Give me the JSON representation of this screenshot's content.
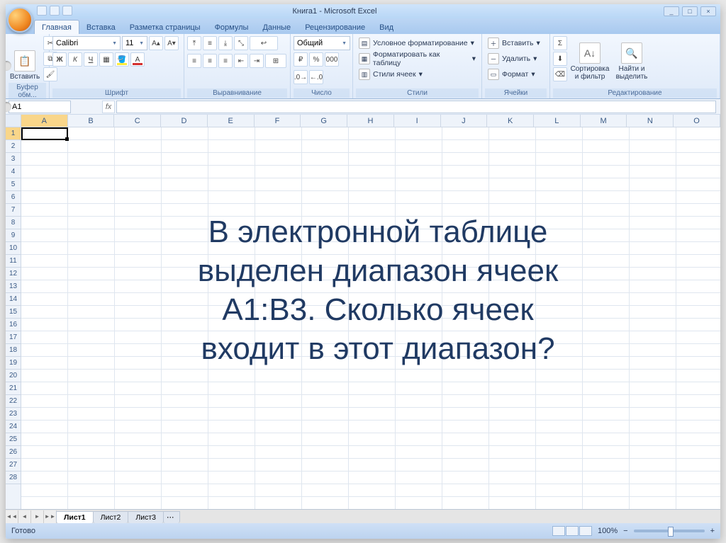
{
  "window": {
    "title": "Книга1 - Microsoft Excel",
    "minimize": "_",
    "maximize": "□",
    "close": "×"
  },
  "tabs": {
    "home": "Главная",
    "insert": "Вставка",
    "layout": "Разметка страницы",
    "formulas": "Формулы",
    "data": "Данные",
    "review": "Рецензирование",
    "view": "Вид"
  },
  "ribbon": {
    "clipboard": {
      "title": "Буфер обм...",
      "paste": "Вставить"
    },
    "font": {
      "title": "Шрифт",
      "name": "Calibri",
      "size": "11",
      "bold": "Ж",
      "italic": "К",
      "underline": "Ч"
    },
    "alignment": {
      "title": "Выравнивание"
    },
    "number": {
      "title": "Число",
      "format": "Общий",
      "percent": "%",
      "thousands": "000"
    },
    "styles": {
      "title": "Стили",
      "conditional": "Условное форматирование",
      "asTable": "Форматировать как таблицу",
      "cellStyles": "Стили ячеек"
    },
    "cells": {
      "title": "Ячейки",
      "insert": "Вставить",
      "delete": "Удалить",
      "format": "Формат"
    },
    "editing": {
      "title": "Редактирование",
      "sigma": "Σ",
      "sort": "Сортировка и фильтр",
      "find": "Найти и выделить"
    }
  },
  "namebox": {
    "cell": "A1",
    "fx": "fx"
  },
  "columns": [
    "A",
    "B",
    "C",
    "D",
    "E",
    "F",
    "G",
    "H",
    "I",
    "J",
    "K",
    "L",
    "M",
    "N",
    "O"
  ],
  "rows_visible": 28,
  "overlay": {
    "line1": "В электронной таблице",
    "line2": "выделен диапазон ячеек",
    "line3": "A1:B3. Сколько ячеек",
    "line4": "входит в этот диапазон?"
  },
  "sheets": {
    "s1": "Лист1",
    "s2": "Лист2",
    "s3": "Лист3"
  },
  "status": {
    "ready": "Готово",
    "zoom": "100%",
    "minus": "−",
    "plus": "+"
  }
}
